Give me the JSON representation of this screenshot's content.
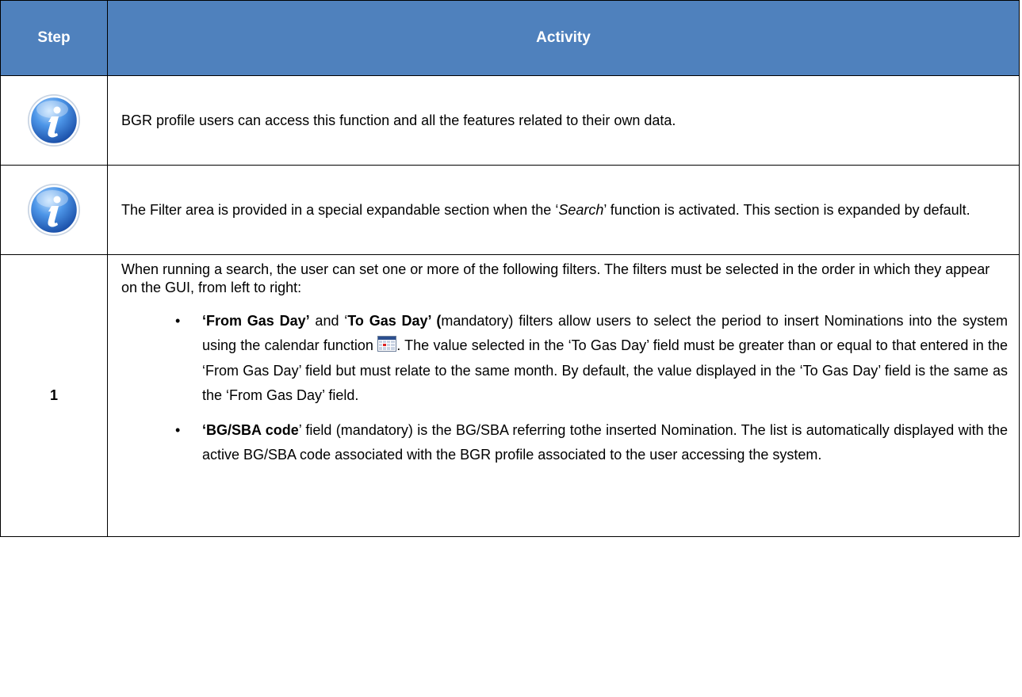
{
  "header": {
    "step_label": "Step",
    "activity_label": "Activity"
  },
  "rows": [
    {
      "step_icon": "info-icon",
      "text": "BGR profile users can access this function and all the features related to their own data."
    },
    {
      "step_icon": "info-icon",
      "text_before": "The Filter area is provided in a special expandable section when the ‘",
      "text_italic": "Search",
      "text_after": "’ function is activated. This section is expanded by default."
    },
    {
      "step_number": "1",
      "intro": "When running a search, the user can set one or more of the following filters. The filters must be selected in the order in which they appear on the GUI, from left to right:",
      "bullets": [
        {
          "bullet": "•",
          "bold1": "‘From Gas Day’",
          "plain1": " and ‘",
          "bold2": "To Gas Day’ (",
          "plain2": "mandatory) filters allow users to select the period to insert Nominations into the system using the calendar function ",
          "icon": "calendar-icon",
          "plain3": ". The value selected in the ‘To Gas Day’ field must be greater than or equal to that entered in the ‘From Gas Day’ field but must relate to the same month. By default, the value displayed in the ‘To Gas Day’ field is the same as the ‘From Gas Day’ field."
        },
        {
          "bullet": "•",
          "bold1": "‘BG/SBA code",
          "plain1": "’ field (mandatory) is the BG/SBA referring tothe inserted Nomination. The list is automatically displayed with the active BG/SBA code associated with the BGR profile associated to the user accessing the system."
        }
      ]
    }
  ],
  "colors": {
    "header_bg": "#4f81bd",
    "header_text": "#ffffff",
    "icon_blue": "#3a7bd5"
  }
}
